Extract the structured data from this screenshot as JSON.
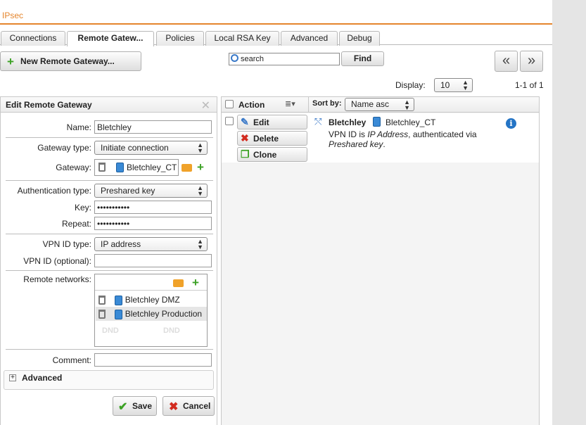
{
  "app": {
    "title": "IPsec"
  },
  "tabs": [
    {
      "label": "Connections"
    },
    {
      "label": "Remote Gatew..."
    },
    {
      "label": "Policies"
    },
    {
      "label": "Local RSA Key"
    },
    {
      "label": "Advanced"
    },
    {
      "label": "Debug"
    }
  ],
  "active_tab": "Remote Gatew...",
  "toolbar": {
    "new_label": "New Remote Gateway...",
    "search_value": "search",
    "find_label": "Find",
    "prev_label": "«",
    "next_label": "»",
    "display_label": "Display:",
    "display_value": "10",
    "count": "1-1 of 1"
  },
  "edit": {
    "title": "Edit Remote Gateway",
    "close": "✕",
    "name_label": "Name:",
    "name_value": "Bletchley",
    "gwtype_label": "Gateway type:",
    "gwtype_value": "Initiate connection",
    "gateway_label": "Gateway:",
    "gateway_value": "Bletchley_CT",
    "auth_label": "Authentication type:",
    "auth_value": "Preshared key",
    "key_label": "Key:",
    "key_value": "•••••••••••",
    "repeat_label": "Repeat:",
    "repeat_value": "•••••••••••",
    "vpnid_type_label": "VPN ID type:",
    "vpnid_type_value": "IP address",
    "vpnid_label": "VPN ID (optional):",
    "vpnid_value": "",
    "remote_label": "Remote networks:",
    "networks": [
      "Bletchley DMZ",
      "Bletchley Production"
    ],
    "dnd": "DND",
    "comment_label": "Comment:",
    "comment_value": "",
    "advanced_label": "Advanced",
    "advanced_toggle": "+",
    "save_label": "Save",
    "cancel_label": "Cancel"
  },
  "grid": {
    "action_header": "Action",
    "sortby_label": "Sort by:",
    "sortby_value": "Name asc",
    "actions": [
      "Edit",
      "Delete",
      "Clone"
    ],
    "row": {
      "name": "Bletchley",
      "gateway": "Bletchley_CT",
      "desc_prefix": "VPN ID is ",
      "desc_italic": "IP Address",
      "desc_mid": ", authenticated via ",
      "desc_italic2": "Preshared key",
      "desc_end": "."
    },
    "info": "i"
  },
  "colors": {
    "accent": "#e5852c",
    "green": "#3ba124",
    "blue": "#2474c5",
    "red": "#d22b1f"
  }
}
